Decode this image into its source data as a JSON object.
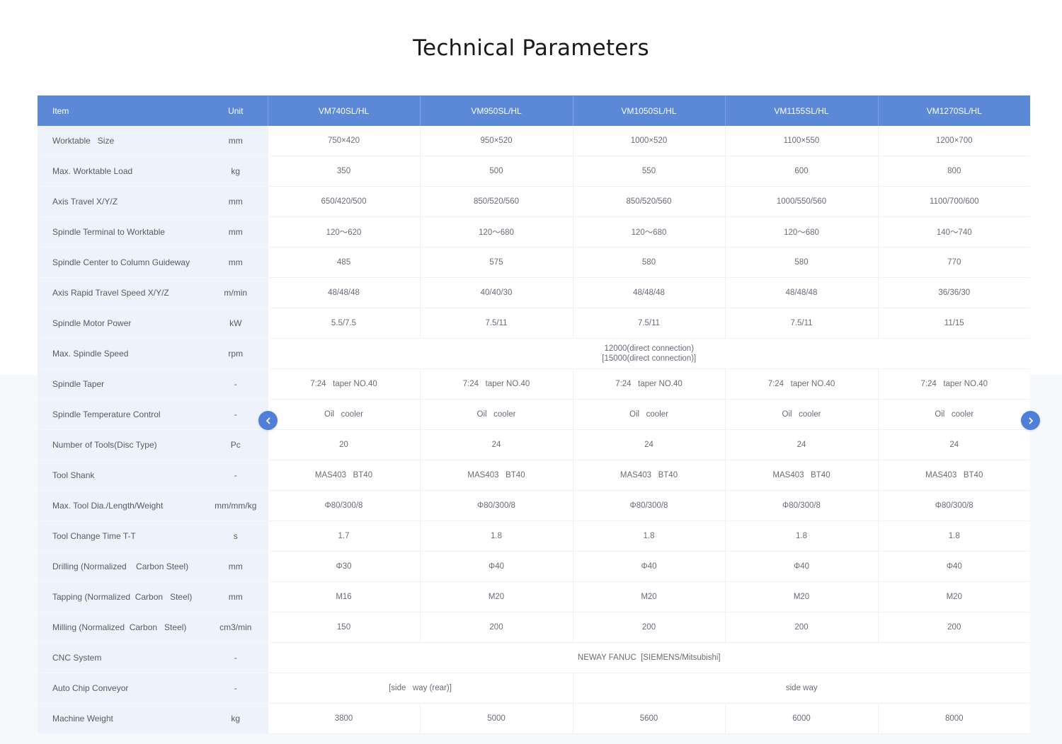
{
  "title": "Technical Parameters",
  "header": {
    "item": "Item",
    "unit": "Unit",
    "models": [
      "VM740SL/HL",
      "VM950SL/HL",
      "VM1050SL/HL",
      "VM1155SL/HL",
      "VM1270SL/HL"
    ]
  },
  "rows": [
    {
      "item": "Worktable   Size",
      "unit": "mm",
      "values": [
        "750×420",
        "950×520",
        "1000×520",
        "1100×550",
        "1200×700"
      ]
    },
    {
      "item": "Max. Worktable Load",
      "unit": "kg",
      "values": [
        "350",
        "500",
        "550",
        "600",
        "800"
      ]
    },
    {
      "item": "Axis Travel X/Y/Z",
      "unit": "mm",
      "values": [
        "650/420/500",
        "850/520/560",
        "850/520/560",
        "1000/550/560",
        "1100/700/600"
      ]
    },
    {
      "item": "Spindle Terminal to Worktable",
      "unit": "mm",
      "values": [
        "120～620",
        "120～680",
        "120～680",
        "120～680",
        "140～740"
      ]
    },
    {
      "item": "Spindle Center to Column Guideway",
      "unit": "mm",
      "values": [
        "485",
        "575",
        "580",
        "580",
        "770"
      ]
    },
    {
      "item": "Axis Rapid Travel Speed X/Y/Z",
      "unit": "m/min",
      "values": [
        "48/48/48",
        "40/40/30",
        "48/48/48",
        "48/48/48",
        "36/36/30"
      ]
    },
    {
      "item": "Spindle Motor Power",
      "unit": "kW",
      "values": [
        "5.5/7.5",
        "7.5/11",
        "7.5/11",
        "7.5/11",
        "11/15"
      ]
    },
    {
      "item": "Max. Spindle Speed",
      "unit": "rpm",
      "merged_line1": "12000(direct connection)",
      "merged_line2": "[15000(direct connection)]"
    },
    {
      "item": "Spindle Taper",
      "unit": "-",
      "values": [
        "7:24   taper NO.40",
        "7:24   taper NO.40",
        "7:24   taper NO.40",
        "7:24   taper NO.40",
        "7:24   taper NO.40"
      ]
    },
    {
      "item": "Spindle Temperature Control",
      "unit": "-",
      "values": [
        "Oil   cooler",
        "Oil   cooler",
        "Oil   cooler",
        "Oil   cooler",
        "Oil   cooler"
      ]
    },
    {
      "item": "Number of Tools(Disc Type)",
      "unit": "Pc",
      "values": [
        "20",
        "24",
        "24",
        "24",
        "24"
      ]
    },
    {
      "item": "Tool Shank",
      "unit": "-",
      "values": [
        "MAS403   BT40",
        "MAS403   BT40",
        "MAS403   BT40",
        "MAS403   BT40",
        "MAS403   BT40"
      ]
    },
    {
      "item": "Max. Tool Dia./Length/Weight",
      "unit": "mm/mm/kg",
      "values": [
        "Φ80/300/8",
        "Φ80/300/8",
        "Φ80/300/8",
        "Φ80/300/8",
        "Φ80/300/8"
      ]
    },
    {
      "item": "Tool Change Time T-T",
      "unit": "s",
      "values": [
        "1.7",
        "1.8",
        "1.8",
        "1.8",
        "1.8"
      ]
    },
    {
      "item": "Drilling (Normalized    Carbon Steel)",
      "unit": "mm",
      "values": [
        "Φ30",
        "Φ40",
        "Φ40",
        "Φ40",
        "Φ40"
      ]
    },
    {
      "item": "Tapping (Normalized  Carbon   Steel)",
      "unit": "mm",
      "values": [
        "M16",
        "M20",
        "M20",
        "M20",
        "M20"
      ]
    },
    {
      "item": "Milling (Normalized  Carbon   Steel)",
      "unit": "cm3/min",
      "values": [
        "150",
        "200",
        "200",
        "200",
        "200"
      ]
    },
    {
      "item": "CNC System",
      "unit": "-",
      "merged": "NEWAY FANUC  [SIEMENS/Mitsubishi]"
    },
    {
      "item": "Auto Chip Conveyor",
      "unit": "-",
      "split": [
        "[side   way (rear)]",
        "side way"
      ]
    },
    {
      "item": "Machine Weight",
      "unit": "kg",
      "values": [
        "3800",
        "5000",
        "5600",
        "6000",
        "8000"
      ]
    }
  ],
  "icons": {
    "prev": "chevron-left-icon",
    "next": "chevron-right-icon"
  },
  "colors": {
    "header_bg": "#5b88d7",
    "arrow_bg": "#4f7fd6",
    "label_col_bg": "#eef2fa"
  }
}
